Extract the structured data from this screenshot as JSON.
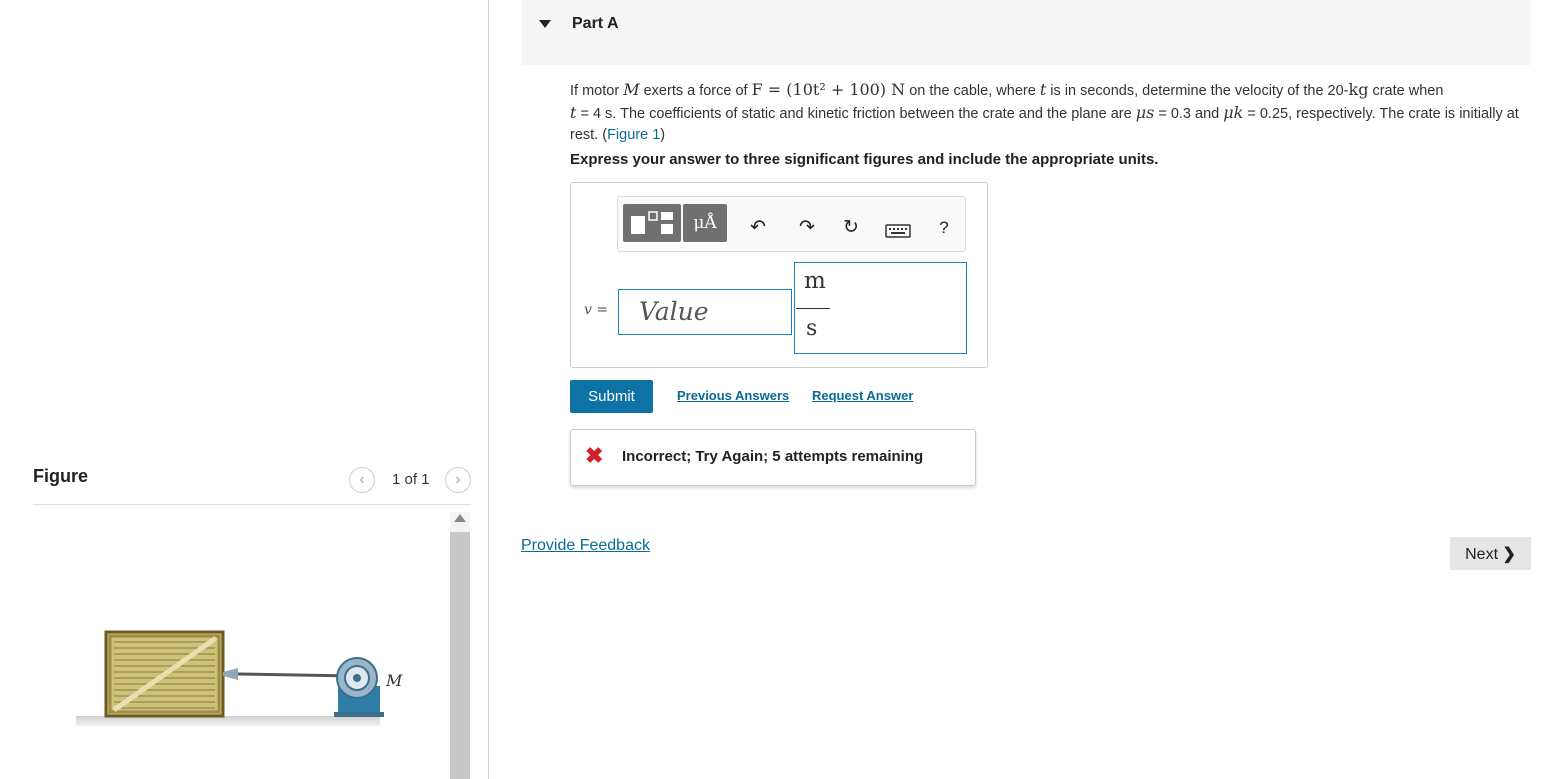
{
  "figure_panel": {
    "title": "Figure",
    "counter": "1 of 1",
    "prev_icon": "chevron-left-icon",
    "next_icon": "chevron-right-icon",
    "motor_label": "M"
  },
  "part": {
    "title": "Part A",
    "problem": {
      "p1": "If motor ",
      "m1": "M",
      "p2": " exerts a force of ",
      "m2": "F = (10t² + 100) N",
      "p3": " on the cable, where ",
      "m3": "t",
      "p4": " is in seconds, determine the velocity of the 20-",
      "m4": "kg",
      "p5": " crate when",
      "m5": "t",
      "p6": " = 4 s. The coefficients of static and kinetic friction between the crate and the plane are ",
      "m6": "μs",
      "p7": " = 0.3 and ",
      "m7": "μk",
      "p8": " = 0.25, respectively. The crate is initially at rest. (",
      "link": "Figure 1",
      "p9": ")"
    },
    "instruction": "Express your answer to three significant figures and include the appropriate units."
  },
  "answer": {
    "units_button": "μÅ",
    "help_label": "?",
    "variable_label": "v =",
    "value_placeholder": "Value",
    "unit_numerator": "m",
    "unit_denominator": "s"
  },
  "actions": {
    "submit": "Submit",
    "previous_answers": "Previous Answers",
    "request_answer": "Request Answer"
  },
  "feedback": {
    "icon": "x-icon",
    "message": "Incorrect; Try Again; 5 attempts remaining"
  },
  "footer": {
    "provide_feedback": "Provide Feedback",
    "next": "Next",
    "next_icon": "chevron-right-icon"
  },
  "colors": {
    "accent": "#0e72a5",
    "link": "#0a6b96",
    "error": "#d4202a"
  }
}
